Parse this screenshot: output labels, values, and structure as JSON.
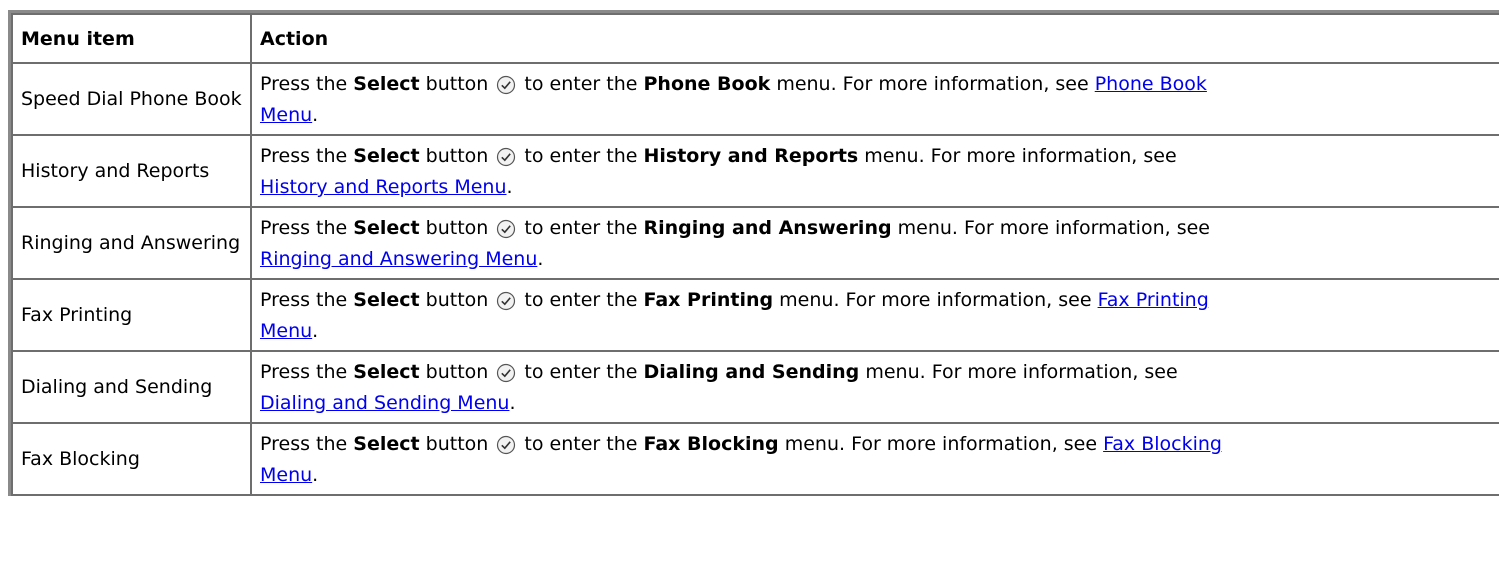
{
  "table": {
    "headers": {
      "col1": "Menu item",
      "col2": "Action"
    },
    "press_text": "Press the",
    "select_word": "Select",
    "button_word": "button",
    "to_enter_the": "to enter the",
    "menu_more_info": "menu. For more information, see",
    "period": ".",
    "rows": [
      {
        "item": "Speed Dial Phone Book",
        "menu_name": "Phone Book",
        "link_text_1": "Phone Book",
        "link_text_2": "Menu"
      },
      {
        "item": "History and Reports",
        "menu_name": "History and Reports",
        "link_text_1": "History and Reports Menu",
        "link_text_2": ""
      },
      {
        "item": "Ringing and Answering",
        "menu_name": "Ringing and Answering",
        "link_text_1": "Ringing and Answering Menu",
        "link_text_2": ""
      },
      {
        "item": "Fax Printing",
        "menu_name": "Fax Printing",
        "link_text_1": "Fax Printing",
        "link_text_2": "Menu"
      },
      {
        "item": "Dialing and Sending",
        "menu_name": "Dialing and Sending",
        "link_text_1": "Dialing and Sending Menu",
        "link_text_2": ""
      },
      {
        "item": "Fax Blocking",
        "menu_name": "Fax Blocking",
        "link_text_1": "Fax Blocking",
        "link_text_2": "Menu"
      }
    ]
  },
  "icons": {
    "select": "select-button-icon"
  },
  "colors": {
    "link": "#0000ee",
    "border": "#6e6e6e",
    "outer_border": "#8a8a8a"
  }
}
